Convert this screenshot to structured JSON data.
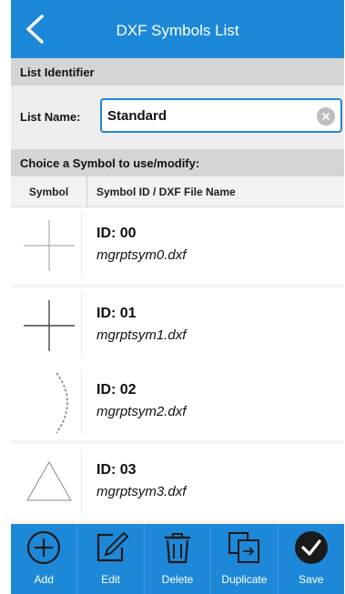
{
  "header": {
    "title": "DXF Symbols List",
    "back_icon": "chevron-left-icon"
  },
  "list_identifier": {
    "section_title": "List Identifier",
    "name_label": "List Name:",
    "name_value": "Standard",
    "clear_icon": "clear-circle-icon"
  },
  "symbols": {
    "section_title": "Choice a Symbol to use/modify:",
    "col_symbol": "Symbol",
    "col_id": "Symbol ID / DXF File Name",
    "items": [
      {
        "id": "ID: 00",
        "file": "mgrptsym0.dxf",
        "icon": "thin-cross-icon"
      },
      {
        "id": "ID: 01",
        "file": "mgrptsym1.dxf",
        "icon": "cross-icon"
      },
      {
        "id": "ID: 02",
        "file": "mgrptsym2.dxf",
        "icon": "arc-icon"
      },
      {
        "id": "ID: 03",
        "file": "mgrptsym3.dxf",
        "icon": "triangle-icon"
      }
    ]
  },
  "toolbar": {
    "add_label": "Add",
    "edit_label": "Edit",
    "delete_label": "Delete",
    "duplicate_label": "Duplicate",
    "save_label": "Save"
  },
  "colors": {
    "accent": "#1e88d8",
    "section_bg": "#d5d5d5"
  }
}
